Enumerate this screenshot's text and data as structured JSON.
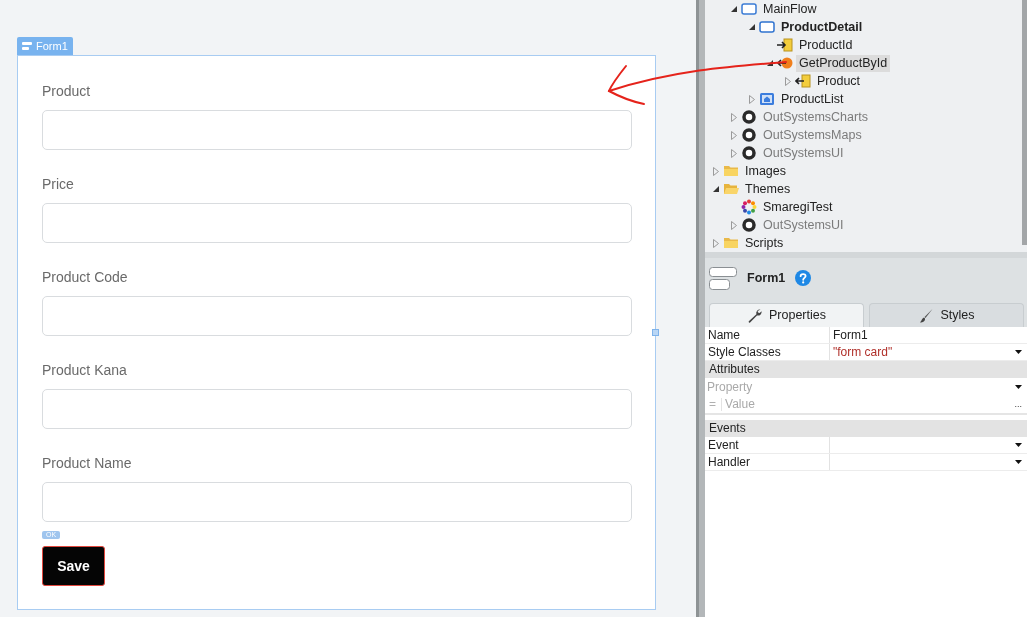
{
  "canvas": {
    "form": {
      "tag": "Form1",
      "fields": [
        {
          "label": "Product"
        },
        {
          "label": "Price"
        },
        {
          "label": "Product Code"
        },
        {
          "label": "Product Kana"
        },
        {
          "label": "Product Name"
        }
      ],
      "badge": "OK",
      "button": "Save"
    }
  },
  "tree": [
    {
      "children": [
        {
          "label": "MainFlow",
          "kind": "flow",
          "expanded": true,
          "selected": false,
          "children": [
            {
              "label": "ProductDetail",
              "kind": "screen",
              "open": true,
              "expanded": true,
              "selected": false,
              "children": [
                {
                  "label": "ProductId",
                  "kind": "input",
                  "selected": false
                },
                {
                  "label": "GetProductById",
                  "kind": "aggregate",
                  "expanded": true,
                  "selected": true,
                  "children": [
                    {
                      "label": "Product",
                      "kind": "output",
                      "expanded": false,
                      "selected": false
                    }
                  ]
                }
              ]
            },
            {
              "label": "ProductList",
              "kind": "home-screen",
              "open": false,
              "expanded": false,
              "selected": false
            }
          ]
        },
        {
          "label": "OutSystemsCharts",
          "kind": "module",
          "expanded": false,
          "selected": false
        },
        {
          "label": "OutSystemsMaps",
          "kind": "module",
          "expanded": false,
          "selected": false
        },
        {
          "label": "OutSystemsUI",
          "kind": "module",
          "expanded": false,
          "selected": false
        }
      ]
    },
    {
      "label": "Images",
      "kind": "folder",
      "expanded": false,
      "selected": false
    },
    {
      "label": "Themes",
      "kind": "folder",
      "expanded": true,
      "selected": false,
      "children": [
        {
          "label": "SmaregiTest",
          "kind": "theme",
          "selected": false
        },
        {
          "label": "OutSystemsUI",
          "kind": "module",
          "expanded": false,
          "selected": false
        }
      ]
    },
    {
      "label": "Scripts",
      "kind": "folder",
      "expanded": false,
      "selected": false
    }
  ],
  "properties": {
    "title": "Form1",
    "tabs": [
      {
        "label": "Properties",
        "kind": "wrench",
        "selected": true
      },
      {
        "label": "Styles",
        "kind": "brush",
        "selected": false
      }
    ],
    "rows": [
      {
        "kind": "property",
        "name": "Name",
        "value": "Form1",
        "expression": false,
        "dropdown": false
      },
      {
        "kind": "property",
        "name": "Style Classes",
        "value": "\"form card\"",
        "expression": true,
        "dropdown": true
      },
      {
        "kind": "section",
        "label": "Attributes"
      },
      {
        "kind": "attribute-name",
        "placeholder": "Property",
        "dropdown": true
      },
      {
        "kind": "attribute-value",
        "operator": "=",
        "placeholder": "Value",
        "more": "..."
      },
      {
        "kind": "section",
        "label": "Events"
      },
      {
        "kind": "property",
        "name": "Event",
        "dropdown": true
      },
      {
        "kind": "property",
        "name": "Handler",
        "dropdown": true
      }
    ]
  }
}
